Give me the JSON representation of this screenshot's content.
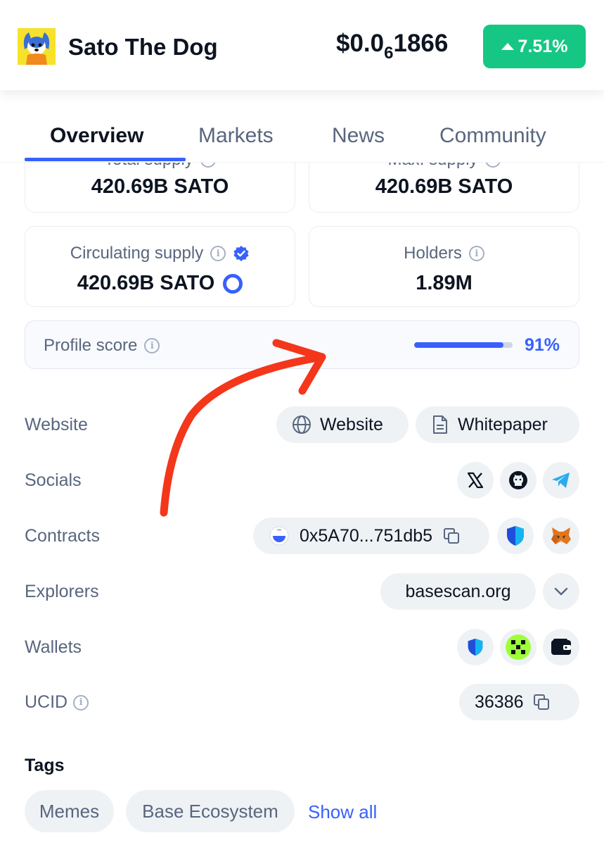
{
  "header": {
    "coin_name": "Sato The Dog",
    "price_prefix": "$0.0",
    "price_zero_count": "6",
    "price_digits": "1866",
    "change_percent": "7.51%",
    "change_color": "#16c784"
  },
  "tabs": [
    {
      "label": "Overview",
      "active": true
    },
    {
      "label": "Markets",
      "active": false
    },
    {
      "label": "News",
      "active": false
    },
    {
      "label": "Community",
      "active": false
    }
  ],
  "stats": {
    "total_supply": {
      "label": "Total supply",
      "value": "420.69B SATO"
    },
    "max_supply": {
      "label": "Max. supply",
      "value": "420.69B SATO"
    },
    "circulating_supply": {
      "label": "Circulating supply",
      "value": "420.69B SATO"
    },
    "holders": {
      "label": "Holders",
      "value": "1.89M"
    }
  },
  "profile_score": {
    "label": "Profile score",
    "value": "91%",
    "fraction": 0.91
  },
  "rows": {
    "website": {
      "label": "Website",
      "links": [
        "Website",
        "Whitepaper"
      ]
    },
    "socials": {
      "label": "Socials",
      "icons": [
        "x-icon",
        "github-icon",
        "telegram-icon"
      ]
    },
    "contracts": {
      "label": "Contracts",
      "address": "0x5A70...751db5"
    },
    "explorers": {
      "label": "Explorers",
      "selected": "basescan.org"
    },
    "wallets": {
      "label": "Wallets",
      "icons": [
        "shield-wallet-icon",
        "okx-wallet-icon",
        "wallet-icon"
      ]
    },
    "ucid": {
      "label": "UCID",
      "value": "36386"
    }
  },
  "tags": {
    "title": "Tags",
    "items": [
      "Memes",
      "Base Ecosystem"
    ],
    "show_all": "Show all"
  },
  "colors": {
    "accent": "#3861fb",
    "positive": "#16c784",
    "annotation": "#f4361a"
  }
}
